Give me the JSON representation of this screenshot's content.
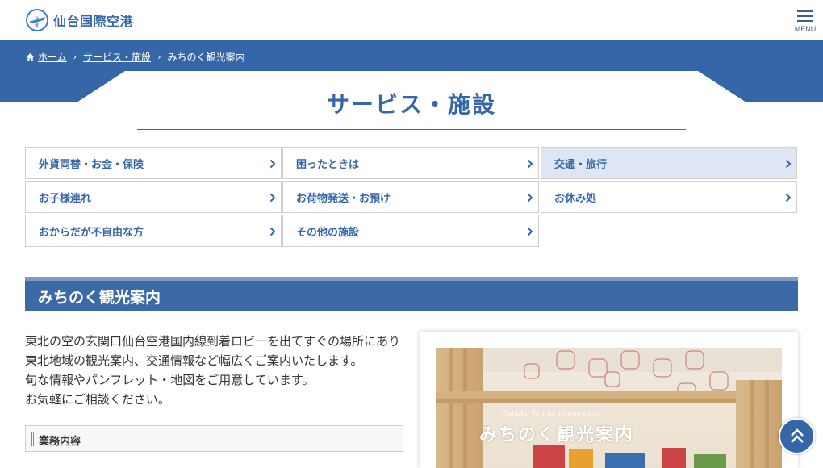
{
  "header": {
    "logo_text": "仙台国際空港",
    "menu_label": "MENU"
  },
  "breadcrumb": {
    "home": "ホーム",
    "parent": "サービス・施設",
    "current": "みちのく観光案内"
  },
  "page_title": "サービス・施設",
  "services": [
    {
      "label": "外貨両替・お金・保険",
      "active": false
    },
    {
      "label": "困ったときは",
      "active": false
    },
    {
      "label": "交通・旅行",
      "active": true
    },
    {
      "label": "お子様連れ",
      "active": false
    },
    {
      "label": "お荷物発送・お預け",
      "active": false
    },
    {
      "label": "お休み処",
      "active": false
    },
    {
      "label": "おからだが不自由な方",
      "active": false
    },
    {
      "label": "その他の施設",
      "active": false
    }
  ],
  "section": {
    "heading": "みちのく観光案内",
    "intro_lines": [
      "東北の空の玄関口仙台空港国内線到着ロビーを出てすぐの場所にあり",
      "東北地域の観光案内、交通情報など幅広くご案内いたします。",
      "旬な情報やパンフレット・地図をご用意しています。",
      "お気軽にご相談ください。"
    ],
    "sub_heading": "業務内容",
    "photo_sign_en": "Tohoku Tourist Information",
    "photo_sign_jp": "みちのく観光案内"
  },
  "colors": {
    "brand": "#3567a8",
    "active_tab": "#dde6f2",
    "section_bar": "#3c6aa6"
  },
  "icons": {
    "home": "home-icon",
    "chevron": "chevron-right-icon",
    "menu": "hamburger-icon",
    "back_to_top": "double-chevron-up-icon"
  }
}
